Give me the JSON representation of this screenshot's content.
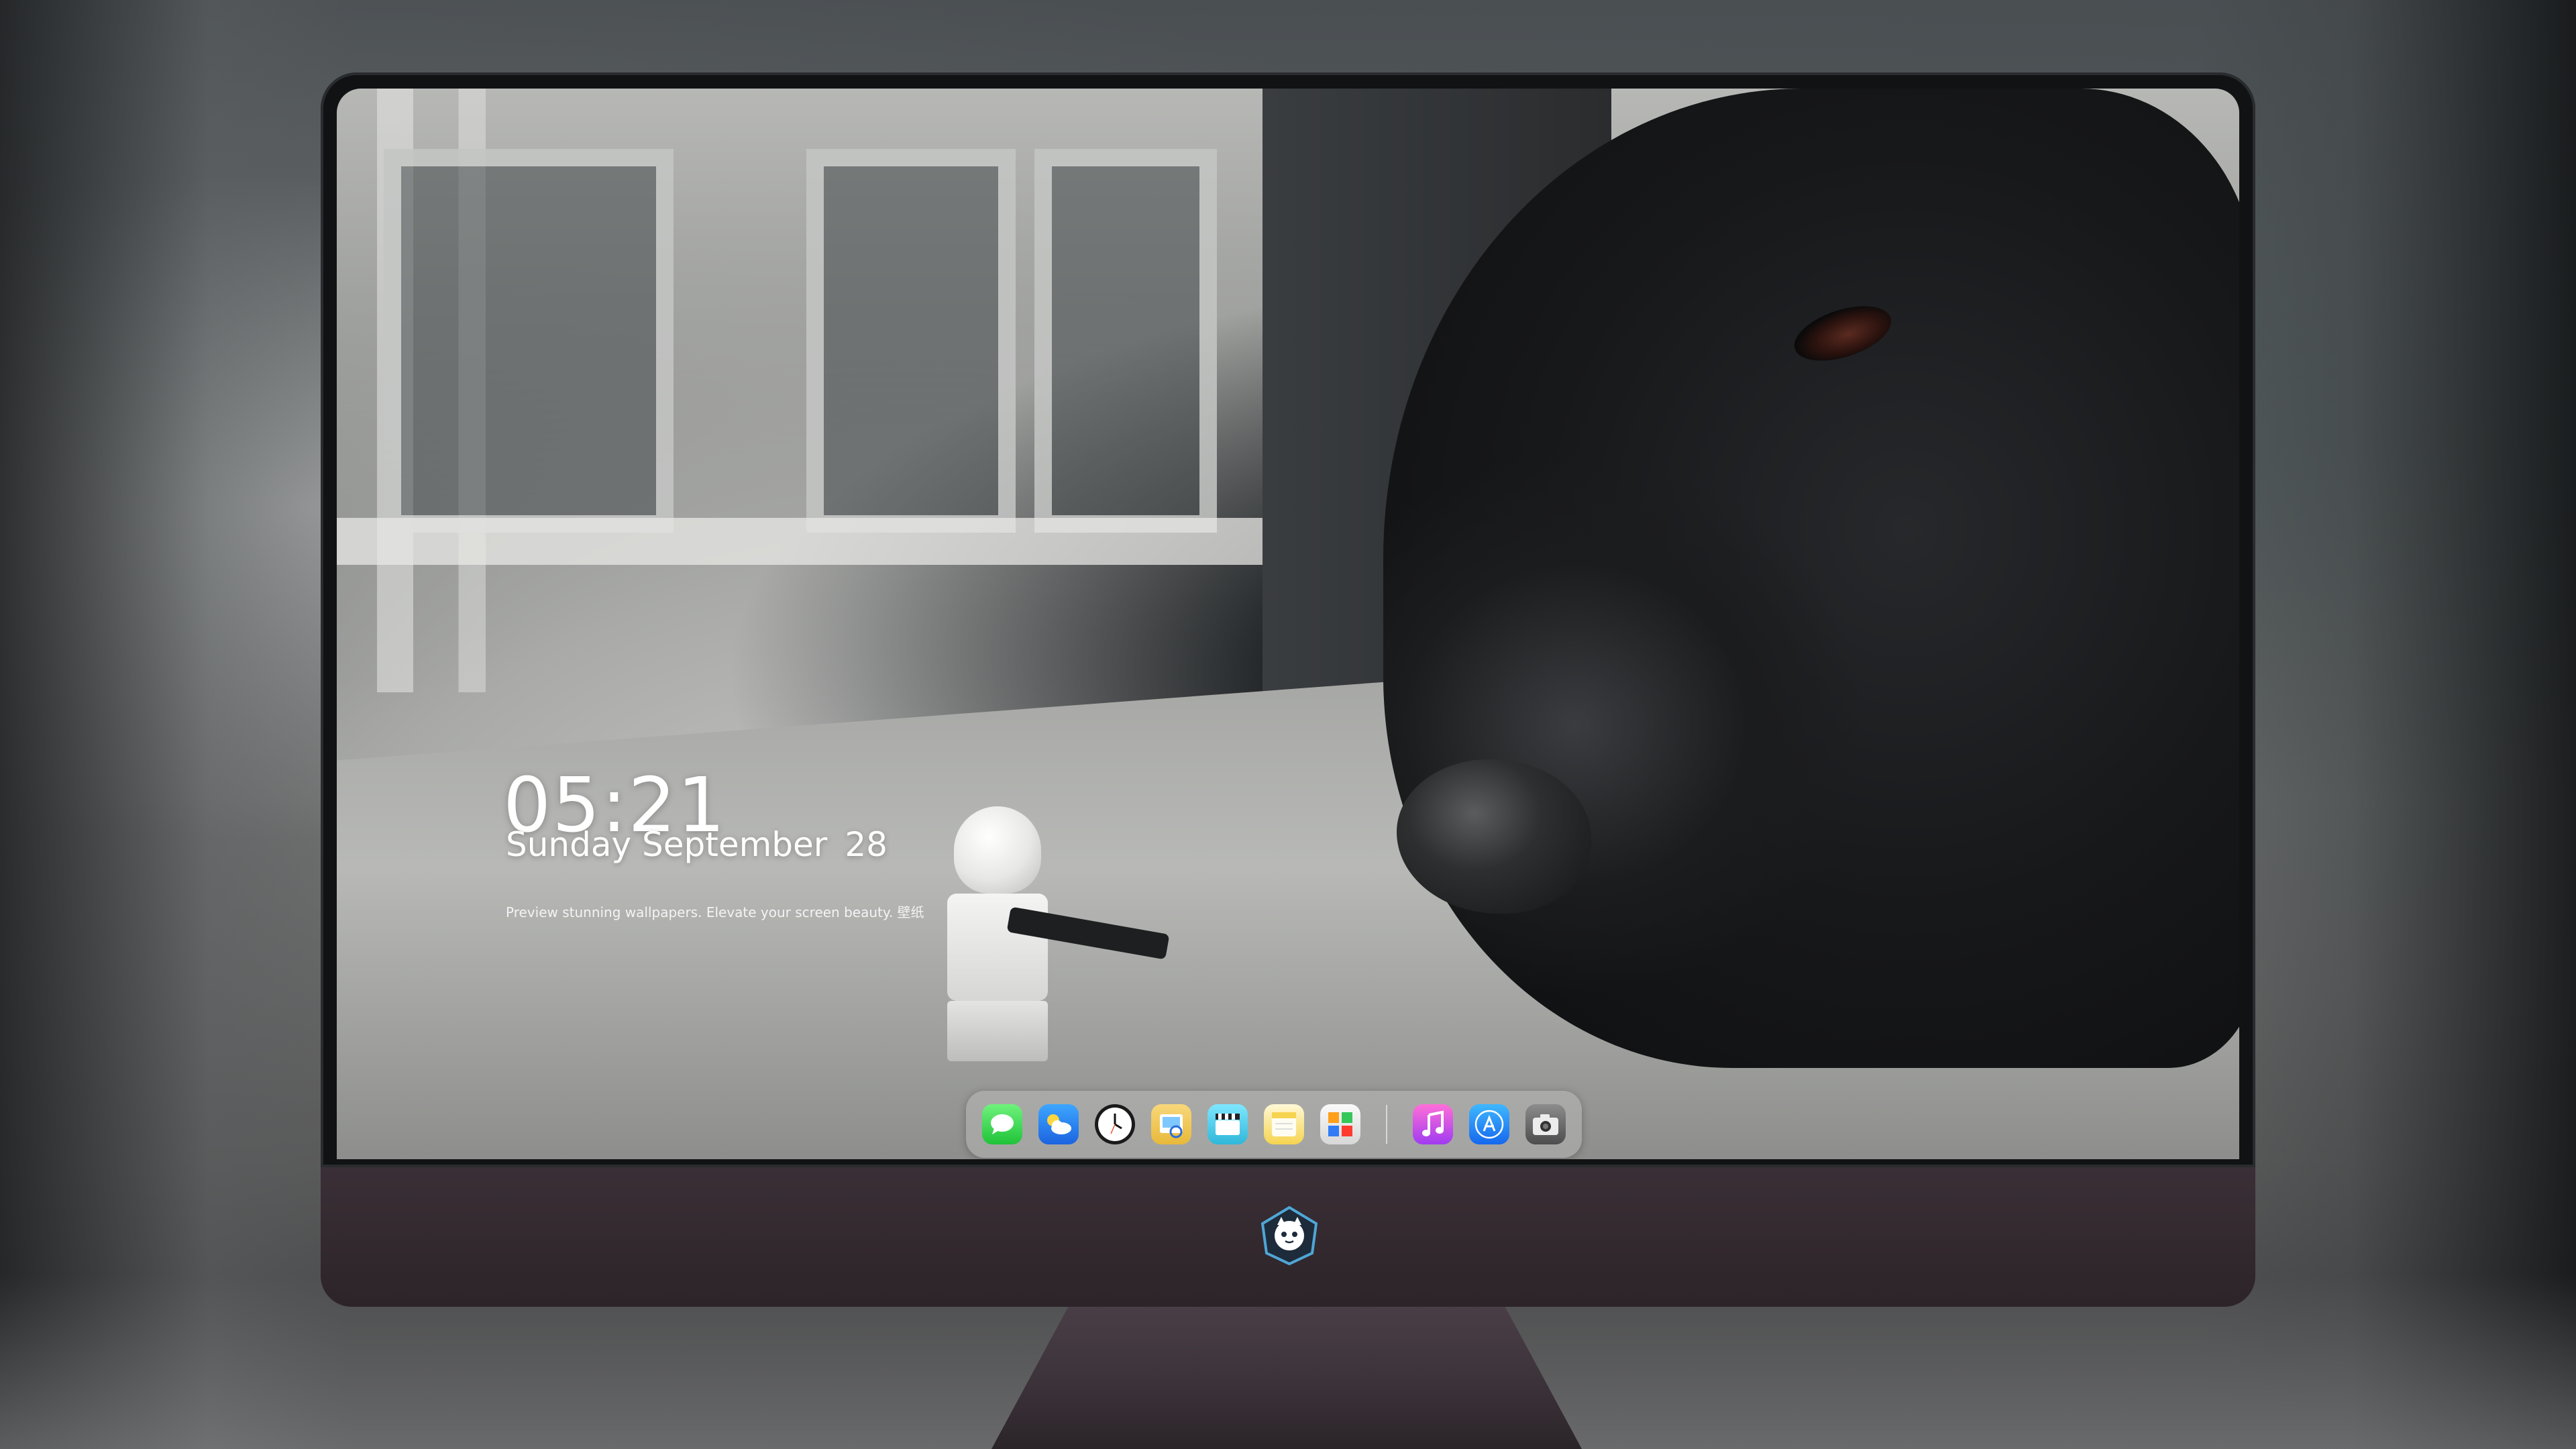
{
  "lock_screen": {
    "time": "05:21",
    "date_day": "Sunday September",
    "date_number": "28",
    "tagline": "Preview stunning wallpapers. Elevate your screen beauty. 壁纸"
  },
  "dock": {
    "items": [
      {
        "name": "Messages",
        "icon": "messages-icon"
      },
      {
        "name": "Weather",
        "icon": "weather-icon"
      },
      {
        "name": "Clock",
        "icon": "clock-icon"
      },
      {
        "name": "Preview",
        "icon": "preview-icon"
      },
      {
        "name": "Claquette",
        "icon": "claquette-icon"
      },
      {
        "name": "Notes",
        "icon": "notes-icon"
      },
      {
        "name": "Photos",
        "icon": "photos-icon"
      },
      {
        "name": "Music",
        "icon": "music-icon"
      },
      {
        "name": "App Store",
        "icon": "app-store-icon"
      },
      {
        "name": "Camera",
        "icon": "camera-icon"
      }
    ]
  },
  "colors": {
    "chin": "#3a2f36",
    "bezel": "#111214",
    "dock_glass": "rgba(200,200,200,0.38)"
  }
}
